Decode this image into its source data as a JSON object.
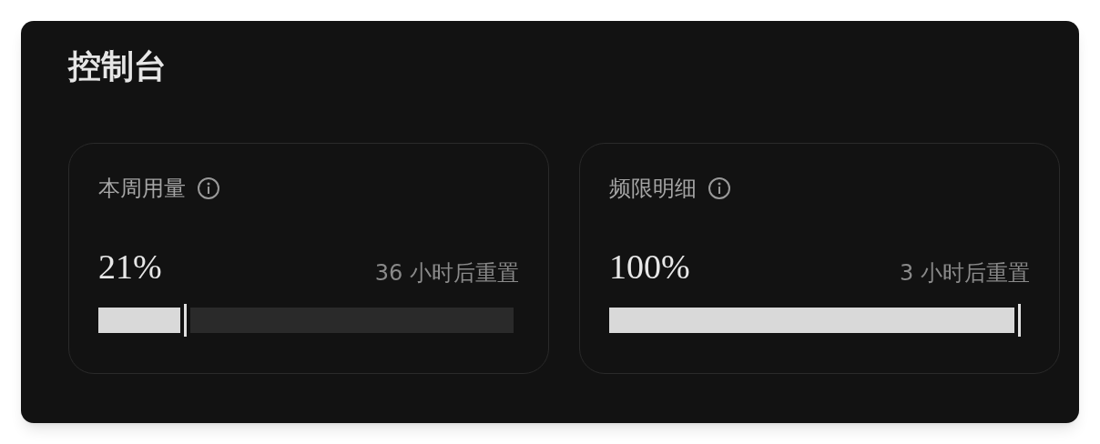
{
  "title": "控制台",
  "cards": [
    {
      "label": "本周用量",
      "percent": "21%",
      "reset": "36 小时后重置",
      "level": 0.21
    },
    {
      "label": "频限明细",
      "percent": "100%",
      "reset": "3 小时后重置",
      "level": 1
    }
  ]
}
